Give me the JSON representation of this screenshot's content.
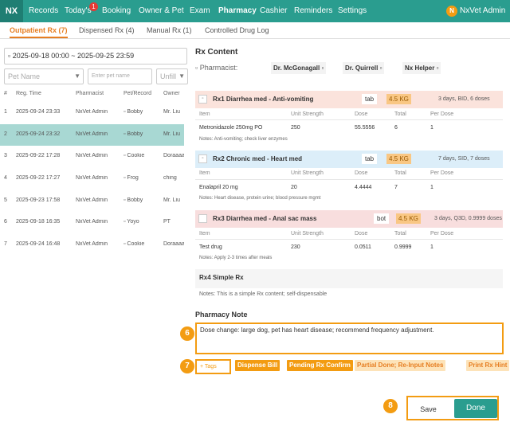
{
  "app": {
    "logo": "NX",
    "user_initial": "N",
    "user_name": "NxVet Admin"
  },
  "nav": {
    "records": "Records",
    "today": "Today's",
    "today_badge": "1",
    "booking": "Booking",
    "owner_pet": "Owner & Pet",
    "exam": "Exam",
    "pharmacy": "Pharmacy",
    "cashier": "Cashier",
    "reminders": "Reminders",
    "settings": "Settings"
  },
  "tabs": {
    "outpatient": "Outpatient Rx (7)",
    "dispensed": "Dispensed Rx (4)",
    "manual": "Manual Rx (1)",
    "controlled": "Controlled Drug Log"
  },
  "filters": {
    "date_range": "2025-09-18 00:00 ~ 2025-09-25 23:59",
    "pet_name": "Pet Name",
    "pet_name_placeholder": "Enter pet name",
    "status": "Unfill"
  },
  "list": {
    "headers": {
      "num": "#",
      "reg_time": "Reg. Time",
      "pharmacist": "Pharmacist",
      "pet": "Pet/Record",
      "owner": "Owner"
    },
    "rows": [
      {
        "num": "1",
        "time": "2025-09-24 23:33",
        "pharmacist": "NxVet Admin",
        "pet": "Bobby",
        "owner": "Mr. Liu"
      },
      {
        "num": "2",
        "time": "2025-09-24 23:32",
        "pharmacist": "NxVet Admin",
        "pet": "Bobby",
        "owner": "Mr. Liu"
      },
      {
        "num": "3",
        "time": "2025-09-22 17:28",
        "pharmacist": "NxVet Admin",
        "pet": "Cookie",
        "owner": "Doraaaa"
      },
      {
        "num": "4",
        "time": "2025-09-22 17:27",
        "pharmacist": "NxVet Admin",
        "pet": "Frog",
        "owner": "ching"
      },
      {
        "num": "5",
        "time": "2025-09-23 17:58",
        "pharmacist": "NxVet Admin",
        "pet": "Bobby",
        "owner": "Mr. Liu"
      },
      {
        "num": "6",
        "time": "2025-09-18 16:35",
        "pharmacist": "NxVet Admin",
        "pet": "Yoyo",
        "owner": "PT"
      },
      {
        "num": "7",
        "time": "2025-09-24 16:48",
        "pharmacist": "NxVet Admin",
        "pet": "Cookie",
        "owner": "Doraaaa"
      }
    ]
  },
  "rx_content": {
    "title": "Rx Content",
    "pharmacist_label": "Pharmacist:",
    "pharmacists": [
      "Dr. McGonagall",
      "Dr. Quirrell",
      "Nx Helper"
    ],
    "col_headers": {
      "item": "Item",
      "unit_strength": "Unit Strength",
      "dose": "Dose",
      "total": "Total",
      "per_dose": "Per Dose"
    },
    "rx1": {
      "title": "Rx1  Diarrhea med - Anti-vomiting",
      "form": "tab",
      "weight": "4.5 KG",
      "schedule": "3 days, BID, 6 doses",
      "item": "Metronidazole 250mg PO",
      "unit": "250",
      "dose": "55.5556",
      "total": "6",
      "per_dose": "1",
      "note": "Notes:   Anti-vomiting; check liver enzymes"
    },
    "rx2": {
      "title": "Rx2  Chronic med - Heart med",
      "form": "tab",
      "weight": "4.5 KG",
      "schedule": "7 days, SID, 7 doses",
      "item": "Enalapril 20 mg",
      "unit": "20",
      "dose": "4.4444",
      "total": "7",
      "per_dose": "1",
      "note": "Notes:   Heart disease, protein urine; blood pressure mgmt"
    },
    "rx3": {
      "title": "Rx3  Diarrhea med - Anal sac mass",
      "form": "bot",
      "weight": "4.5 KG",
      "schedule": "3 days, Q3D, 0.9999 doses",
      "item": "Test drug",
      "unit": "230",
      "dose": "0.0511",
      "total": "0.9999",
      "per_dose": "1",
      "note": "Notes:  Apply 2-3 times after meals"
    },
    "rx4": {
      "title": "Rx4  Simple Rx",
      "note": "Notes: This is a simple Rx content; self-dispensable"
    }
  },
  "pharmacy_note": {
    "title": "Pharmacy Note",
    "text": "Dose change: large dog, pet has heart disease; recommend frequency adjustment."
  },
  "actions": {
    "tags": "+ Tags",
    "dispense_bill": "Dispense Bill",
    "pending_confirm": "Pending Rx Confirm",
    "partial_done": "Partial Done; Re-Input Notes",
    "print_hint": "Print Rx Hint",
    "save": "Save",
    "done": "Done"
  },
  "steps": {
    "s6": "6",
    "s7": "7",
    "s8": "8"
  }
}
